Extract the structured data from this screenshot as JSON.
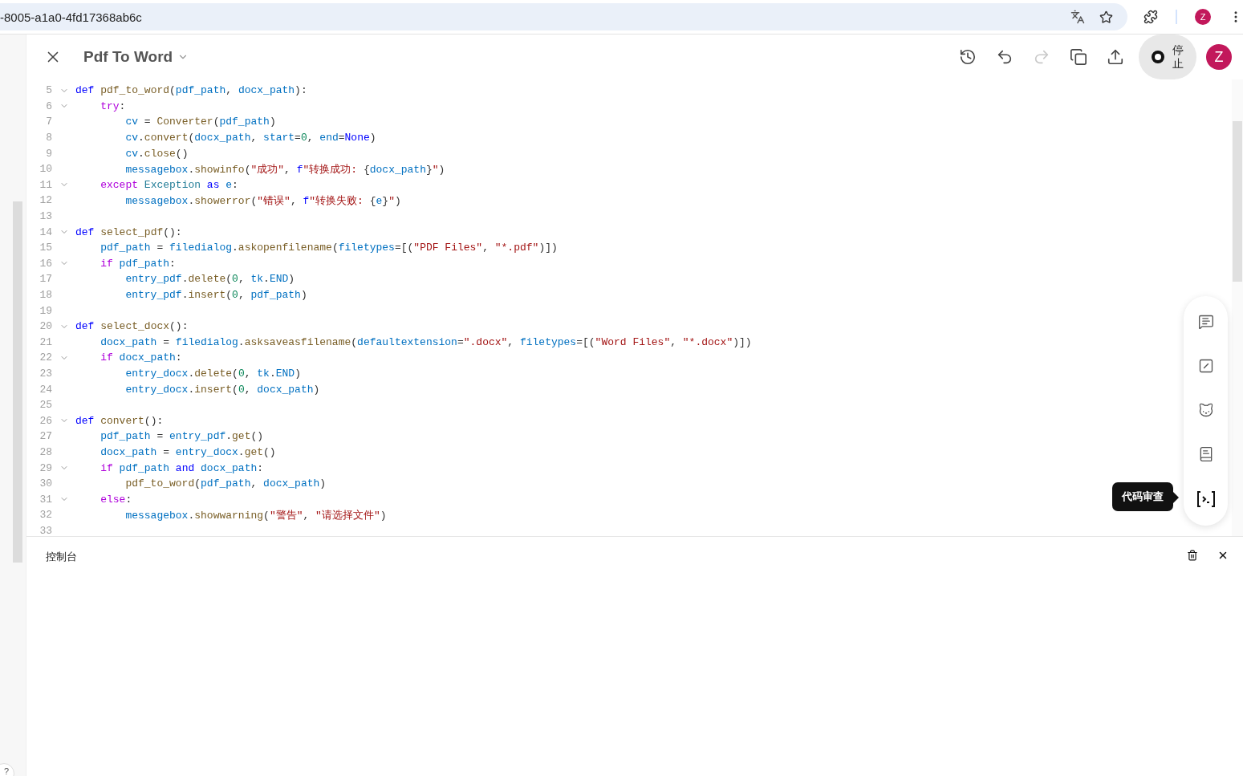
{
  "browser": {
    "url": "-8005-a1a0-4fd17368ab6c",
    "avatar": "Z"
  },
  "header": {
    "title": "Pdf To Word",
    "actions": [
      {
        "kind": "history",
        "disabled": false
      },
      {
        "kind": "undo",
        "disabled": false
      },
      {
        "kind": "redo",
        "disabled": true
      },
      {
        "kind": "copy",
        "disabled": false
      },
      {
        "kind": "share",
        "disabled": false
      }
    ],
    "run_button": {
      "label": "停止"
    },
    "avatar": "Z"
  },
  "editor": {
    "lines": [
      {
        "number": "5",
        "fold": true,
        "tokens": [
          {
            "kind": "kw",
            "text": "def "
          },
          {
            "kind": "fn",
            "text": "pdf_to_word"
          },
          {
            "kind": "p",
            "text": "("
          },
          {
            "kind": "var",
            "text": "pdf_path"
          },
          {
            "kind": "p",
            "text": ", "
          },
          {
            "kind": "var",
            "text": "docx_path"
          },
          {
            "kind": "p",
            "text": "):"
          }
        ]
      },
      {
        "number": "6",
        "fold": true,
        "tokens": [
          {
            "kind": "ctl",
            "text": "    try"
          },
          {
            "kind": "p",
            "text": ":"
          }
        ]
      },
      {
        "number": "7",
        "fold": false,
        "tokens": [
          {
            "kind": "var",
            "text": "        cv"
          },
          {
            "kind": "p",
            "text": " = "
          },
          {
            "kind": "fn",
            "text": "Converter"
          },
          {
            "kind": "p",
            "text": "("
          },
          {
            "kind": "var",
            "text": "pdf_path"
          },
          {
            "kind": "p",
            "text": ")"
          }
        ]
      },
      {
        "number": "8",
        "fold": false,
        "tokens": [
          {
            "kind": "var",
            "text": "        cv"
          },
          {
            "kind": "p",
            "text": "."
          },
          {
            "kind": "fn",
            "text": "convert"
          },
          {
            "kind": "p",
            "text": "("
          },
          {
            "kind": "var",
            "text": "docx_path"
          },
          {
            "kind": "p",
            "text": ", "
          },
          {
            "kind": "var",
            "text": "start"
          },
          {
            "kind": "p",
            "text": "="
          },
          {
            "kind": "num",
            "text": "0"
          },
          {
            "kind": "p",
            "text": ", "
          },
          {
            "kind": "var",
            "text": "end"
          },
          {
            "kind": "p",
            "text": "="
          },
          {
            "kind": "kw",
            "text": "None"
          },
          {
            "kind": "p",
            "text": ")"
          }
        ]
      },
      {
        "number": "9",
        "fold": false,
        "tokens": [
          {
            "kind": "var",
            "text": "        cv"
          },
          {
            "kind": "p",
            "text": "."
          },
          {
            "kind": "fn",
            "text": "close"
          },
          {
            "kind": "p",
            "text": "()"
          }
        ]
      },
      {
        "number": "10",
        "fold": false,
        "tokens": [
          {
            "kind": "var",
            "text": "        messagebox"
          },
          {
            "kind": "p",
            "text": "."
          },
          {
            "kind": "fn",
            "text": "showinfo"
          },
          {
            "kind": "p",
            "text": "("
          },
          {
            "kind": "str",
            "text": "\"成功\""
          },
          {
            "kind": "p",
            "text": ", "
          },
          {
            "kind": "kw",
            "text": "f"
          },
          {
            "kind": "str",
            "text": "\"转换成功: "
          },
          {
            "kind": "p",
            "text": "{"
          },
          {
            "kind": "var",
            "text": "docx_path"
          },
          {
            "kind": "p",
            "text": "}"
          },
          {
            "kind": "str",
            "text": "\""
          },
          {
            "kind": "p",
            "text": ")"
          }
        ]
      },
      {
        "number": "11",
        "fold": true,
        "tokens": [
          {
            "kind": "ctl",
            "text": "    except "
          },
          {
            "kind": "cls",
            "text": "Exception "
          },
          {
            "kind": "kw",
            "text": "as "
          },
          {
            "kind": "var",
            "text": "e"
          },
          {
            "kind": "p",
            "text": ":"
          }
        ]
      },
      {
        "number": "12",
        "fold": false,
        "tokens": [
          {
            "kind": "var",
            "text": "        messagebox"
          },
          {
            "kind": "p",
            "text": "."
          },
          {
            "kind": "fn",
            "text": "showerror"
          },
          {
            "kind": "p",
            "text": "("
          },
          {
            "kind": "str",
            "text": "\"错误\""
          },
          {
            "kind": "p",
            "text": ", "
          },
          {
            "kind": "kw",
            "text": "f"
          },
          {
            "kind": "str",
            "text": "\"转换失败: "
          },
          {
            "kind": "p",
            "text": "{"
          },
          {
            "kind": "var",
            "text": "e"
          },
          {
            "kind": "p",
            "text": "}"
          },
          {
            "kind": "str",
            "text": "\""
          },
          {
            "kind": "p",
            "text": ")"
          }
        ]
      },
      {
        "number": "13",
        "fold": false
      },
      {
        "number": "14",
        "fold": true,
        "tokens": [
          {
            "kind": "kw",
            "text": "def "
          },
          {
            "kind": "fn",
            "text": "select_pdf"
          },
          {
            "kind": "p",
            "text": "():"
          }
        ]
      },
      {
        "number": "15",
        "fold": false,
        "tokens": [
          {
            "kind": "var",
            "text": "    pdf_path"
          },
          {
            "kind": "p",
            "text": " = "
          },
          {
            "kind": "var",
            "text": "filedialog"
          },
          {
            "kind": "p",
            "text": "."
          },
          {
            "kind": "fn",
            "text": "askopenfilename"
          },
          {
            "kind": "p",
            "text": "("
          },
          {
            "kind": "var",
            "text": "filetypes"
          },
          {
            "kind": "p",
            "text": "=[("
          },
          {
            "kind": "str",
            "text": "\"PDF Files\""
          },
          {
            "kind": "p",
            "text": ", "
          },
          {
            "kind": "str",
            "text": "\"*.pdf\""
          },
          {
            "kind": "p",
            "text": ")])"
          }
        ]
      },
      {
        "number": "16",
        "fold": true,
        "tokens": [
          {
            "kind": "ctl",
            "text": "    if "
          },
          {
            "kind": "var",
            "text": "pdf_path"
          },
          {
            "kind": "p",
            "text": ":"
          }
        ]
      },
      {
        "number": "17",
        "fold": false,
        "tokens": [
          {
            "kind": "var",
            "text": "        entry_pdf"
          },
          {
            "kind": "p",
            "text": "."
          },
          {
            "kind": "fn",
            "text": "delete"
          },
          {
            "kind": "p",
            "text": "("
          },
          {
            "kind": "num",
            "text": "0"
          },
          {
            "kind": "p",
            "text": ", "
          },
          {
            "kind": "var",
            "text": "tk"
          },
          {
            "kind": "p",
            "text": "."
          },
          {
            "kind": "var",
            "text": "END"
          },
          {
            "kind": "p",
            "text": ")"
          }
        ]
      },
      {
        "number": "18",
        "fold": false,
        "tokens": [
          {
            "kind": "var",
            "text": "        entry_pdf"
          },
          {
            "kind": "p",
            "text": "."
          },
          {
            "kind": "fn",
            "text": "insert"
          },
          {
            "kind": "p",
            "text": "("
          },
          {
            "kind": "num",
            "text": "0"
          },
          {
            "kind": "p",
            "text": ", "
          },
          {
            "kind": "var",
            "text": "pdf_path"
          },
          {
            "kind": "p",
            "text": ")"
          }
        ]
      },
      {
        "number": "19",
        "fold": false
      },
      {
        "number": "20",
        "fold": true,
        "tokens": [
          {
            "kind": "kw",
            "text": "def "
          },
          {
            "kind": "fn",
            "text": "select_docx"
          },
          {
            "kind": "p",
            "text": "():"
          }
        ]
      },
      {
        "number": "21",
        "fold": false,
        "tokens": [
          {
            "kind": "var",
            "text": "    docx_path"
          },
          {
            "kind": "p",
            "text": " = "
          },
          {
            "kind": "var",
            "text": "filedialog"
          },
          {
            "kind": "p",
            "text": "."
          },
          {
            "kind": "fn",
            "text": "asksaveasfilename"
          },
          {
            "kind": "p",
            "text": "("
          },
          {
            "kind": "var",
            "text": "defaultextension"
          },
          {
            "kind": "p",
            "text": "="
          },
          {
            "kind": "str",
            "text": "\".docx\""
          },
          {
            "kind": "p",
            "text": ", "
          },
          {
            "kind": "var",
            "text": "filetypes"
          },
          {
            "kind": "p",
            "text": "=[("
          },
          {
            "kind": "str",
            "text": "\"Word Files\""
          },
          {
            "kind": "p",
            "text": ", "
          },
          {
            "kind": "str",
            "text": "\"*.docx\""
          },
          {
            "kind": "p",
            "text": ")])"
          }
        ]
      },
      {
        "number": "22",
        "fold": true,
        "tokens": [
          {
            "kind": "ctl",
            "text": "    if "
          },
          {
            "kind": "var",
            "text": "docx_path"
          },
          {
            "kind": "p",
            "text": ":"
          }
        ]
      },
      {
        "number": "23",
        "fold": false,
        "tokens": [
          {
            "kind": "var",
            "text": "        entry_docx"
          },
          {
            "kind": "p",
            "text": "."
          },
          {
            "kind": "fn",
            "text": "delete"
          },
          {
            "kind": "p",
            "text": "("
          },
          {
            "kind": "num",
            "text": "0"
          },
          {
            "kind": "p",
            "text": ", "
          },
          {
            "kind": "var",
            "text": "tk"
          },
          {
            "kind": "p",
            "text": "."
          },
          {
            "kind": "var",
            "text": "END"
          },
          {
            "kind": "p",
            "text": ")"
          }
        ]
      },
      {
        "number": "24",
        "fold": false,
        "tokens": [
          {
            "kind": "var",
            "text": "        entry_docx"
          },
          {
            "kind": "p",
            "text": "."
          },
          {
            "kind": "fn",
            "text": "insert"
          },
          {
            "kind": "p",
            "text": "("
          },
          {
            "kind": "num",
            "text": "0"
          },
          {
            "kind": "p",
            "text": ", "
          },
          {
            "kind": "var",
            "text": "docx_path"
          },
          {
            "kind": "p",
            "text": ")"
          }
        ]
      },
      {
        "number": "25",
        "fold": false
      },
      {
        "number": "26",
        "fold": true,
        "tokens": [
          {
            "kind": "kw",
            "text": "def "
          },
          {
            "kind": "fn",
            "text": "convert"
          },
          {
            "kind": "p",
            "text": "():"
          }
        ]
      },
      {
        "number": "27",
        "fold": false,
        "tokens": [
          {
            "kind": "var",
            "text": "    pdf_path"
          },
          {
            "kind": "p",
            "text": " = "
          },
          {
            "kind": "var",
            "text": "entry_pdf"
          },
          {
            "kind": "p",
            "text": "."
          },
          {
            "kind": "fn",
            "text": "get"
          },
          {
            "kind": "p",
            "text": "()"
          }
        ]
      },
      {
        "number": "28",
        "fold": false,
        "tokens": [
          {
            "kind": "var",
            "text": "    docx_path"
          },
          {
            "kind": "p",
            "text": " = "
          },
          {
            "kind": "var",
            "text": "entry_docx"
          },
          {
            "kind": "p",
            "text": "."
          },
          {
            "kind": "fn",
            "text": "get"
          },
          {
            "kind": "p",
            "text": "()"
          }
        ]
      },
      {
        "number": "29",
        "fold": true,
        "tokens": [
          {
            "kind": "ctl",
            "text": "    if "
          },
          {
            "kind": "var",
            "text": "pdf_path "
          },
          {
            "kind": "kw",
            "text": "and "
          },
          {
            "kind": "var",
            "text": "docx_path"
          },
          {
            "kind": "p",
            "text": ":"
          }
        ]
      },
      {
        "number": "30",
        "fold": false,
        "tokens": [
          {
            "kind": "fn",
            "text": "        pdf_to_word"
          },
          {
            "kind": "p",
            "text": "("
          },
          {
            "kind": "var",
            "text": "pdf_path"
          },
          {
            "kind": "p",
            "text": ", "
          },
          {
            "kind": "var",
            "text": "docx_path"
          },
          {
            "kind": "p",
            "text": ")"
          }
        ]
      },
      {
        "number": "31",
        "fold": true,
        "tokens": [
          {
            "kind": "ctl",
            "text": "    else"
          },
          {
            "kind": "p",
            "text": ":"
          }
        ]
      },
      {
        "number": "32",
        "fold": false,
        "tokens": [
          {
            "kind": "var",
            "text": "        messagebox"
          },
          {
            "kind": "p",
            "text": "."
          },
          {
            "kind": "fn",
            "text": "showwarning"
          },
          {
            "kind": "p",
            "text": "("
          },
          {
            "kind": "str",
            "text": "\"警告\""
          },
          {
            "kind": "p",
            "text": ", "
          },
          {
            "kind": "str",
            "text": "\"请选择文件\""
          },
          {
            "kind": "p",
            "text": ")"
          }
        ]
      },
      {
        "number": "33",
        "fold": false
      }
    ]
  },
  "tools": {
    "tooltip": "代码审查"
  },
  "console": {
    "title": "控制台"
  },
  "help": {
    "label": "?"
  }
}
